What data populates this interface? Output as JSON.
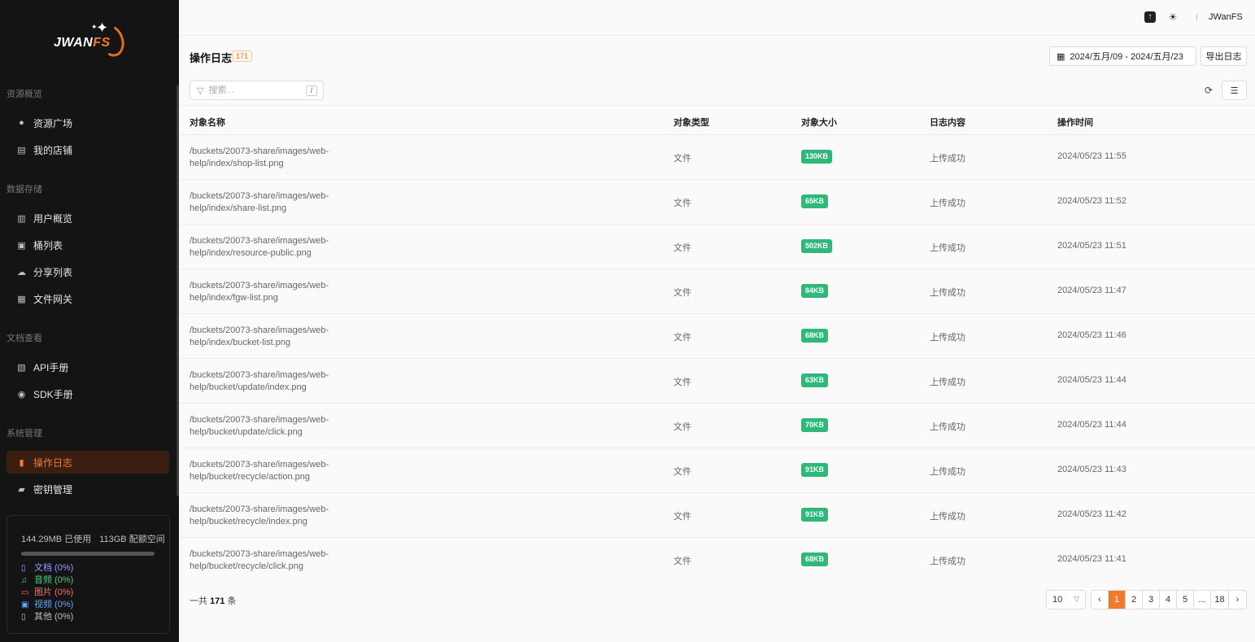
{
  "app": {
    "logo_text": "JWAN",
    "logo_accent": "FS"
  },
  "sidebar": {
    "sections": [
      {
        "title": "资源概览",
        "items": [
          {
            "label": "资源广场",
            "icon": "globe-icon"
          },
          {
            "label": "我的店铺",
            "icon": "store-icon"
          }
        ]
      },
      {
        "title": "数据存储",
        "items": [
          {
            "label": "用户概览",
            "icon": "bar-chart-icon"
          },
          {
            "label": "桶列表",
            "icon": "bucket-icon"
          },
          {
            "label": "分享列表",
            "icon": "share-icon"
          },
          {
            "label": "文件网关",
            "icon": "gateway-icon"
          }
        ]
      },
      {
        "title": "文档查看",
        "items": [
          {
            "label": "API手册",
            "icon": "api-icon"
          },
          {
            "label": "SDK手册",
            "icon": "sdk-icon"
          }
        ]
      },
      {
        "title": "系统管理",
        "items": [
          {
            "label": "操作日志",
            "icon": "clipboard-icon",
            "active": true
          },
          {
            "label": "密钥管理",
            "icon": "key-folder-icon"
          }
        ]
      }
    ],
    "storage": {
      "used": "144.29MB 已使用",
      "quota": "113GB 配额空间",
      "usage_fraction": 0.0,
      "legend": [
        {
          "label": "文档 (0%)",
          "color": "#8f9cff",
          "icon": "document-icon"
        },
        {
          "label": "音频 (0%)",
          "color": "#4fd07b",
          "icon": "music-icon"
        },
        {
          "label": "图片 (0%)",
          "color": "#ff6b6b",
          "icon": "image-icon"
        },
        {
          "label": "视频 (0%)",
          "color": "#5aa9ff",
          "icon": "video-icon"
        },
        {
          "label": "其他 (0%)",
          "color": "#bfbfbf",
          "icon": "file-icon"
        }
      ]
    }
  },
  "topbar": {
    "username": "JWanFS"
  },
  "main": {
    "title": "操作日志",
    "count": "171",
    "date_range": "2024/五月/09 - 2024/五月/23",
    "export_label": "导出日志",
    "search_placeholder": "搜索...",
    "search_shortcut": "/",
    "columns": [
      "对象名称",
      "对象类型",
      "对象大小",
      "日志内容",
      "操作时间"
    ],
    "rows": [
      {
        "name": "/buckets/20073-share/images/web-help/index/shop-list.png",
        "type": "文件",
        "size": "130KB",
        "log": "上传成功",
        "time": "2024/05/23 11:55"
      },
      {
        "name": "/buckets/20073-share/images/web-help/index/share-list.png",
        "type": "文件",
        "size": "65KB",
        "log": "上传成功",
        "time": "2024/05/23 11:52"
      },
      {
        "name": "/buckets/20073-share/images/web-help/index/resource-public.png",
        "type": "文件",
        "size": "502KB",
        "log": "上传成功",
        "time": "2024/05/23 11:51"
      },
      {
        "name": "/buckets/20073-share/images/web-help/index/fgw-list.png",
        "type": "文件",
        "size": "84KB",
        "log": "上传成功",
        "time": "2024/05/23 11:47"
      },
      {
        "name": "/buckets/20073-share/images/web-help/index/bucket-list.png",
        "type": "文件",
        "size": "68KB",
        "log": "上传成功",
        "time": "2024/05/23 11:46"
      },
      {
        "name": "/buckets/20073-share/images/web-help/bucket/update/index.png",
        "type": "文件",
        "size": "63KB",
        "log": "上传成功",
        "time": "2024/05/23 11:44"
      },
      {
        "name": "/buckets/20073-share/images/web-help/bucket/update/click.png",
        "type": "文件",
        "size": "70KB",
        "log": "上传成功",
        "time": "2024/05/23 11:44"
      },
      {
        "name": "/buckets/20073-share/images/web-help/bucket/recycle/action.png",
        "type": "文件",
        "size": "91KB",
        "log": "上传成功",
        "time": "2024/05/23 11:43"
      },
      {
        "name": "/buckets/20073-share/images/web-help/bucket/recycle/index.png",
        "type": "文件",
        "size": "91KB",
        "log": "上传成功",
        "time": "2024/05/23 11:42"
      },
      {
        "name": "/buckets/20073-share/images/web-help/bucket/recycle/click.png",
        "type": "文件",
        "size": "68KB",
        "log": "上传成功",
        "time": "2024/05/23 11:41"
      }
    ],
    "footer": {
      "total_prefix": "一共",
      "total_count": "171",
      "total_suffix": "条",
      "page_size": "10",
      "pages": [
        "‹",
        "1",
        "2",
        "3",
        "4",
        "5",
        "...",
        "18",
        "›"
      ],
      "current_page": "1"
    }
  },
  "colors": {
    "accent": "#f07c2b",
    "size_badge": "#2eb87a",
    "sidebar_bg": "#141414"
  }
}
